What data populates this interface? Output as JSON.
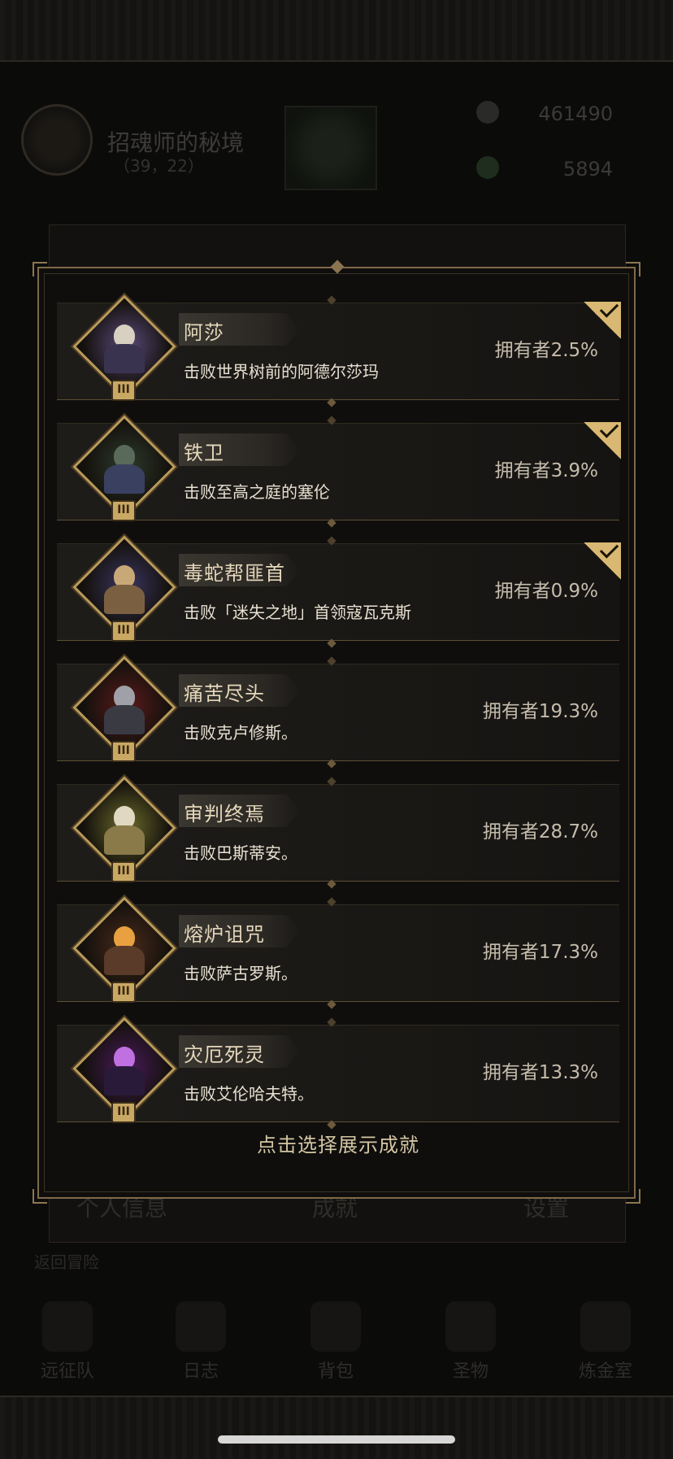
{
  "background": {
    "location_title": "招魂师的秘境",
    "location_coord": "（39，22）",
    "gem_count": "461490",
    "energy_count": "5894",
    "profile_tabs": [
      "个人信息",
      "成就",
      "设置"
    ],
    "back_label": "返回冒险",
    "nav": [
      {
        "label": "远征队",
        "icon": "horned-helmet-icon"
      },
      {
        "label": "日志",
        "icon": "scroll-icon"
      },
      {
        "label": "背包",
        "icon": "bag-icon"
      },
      {
        "label": "圣物",
        "icon": "relic-icon"
      },
      {
        "label": "炼金室",
        "icon": "alchemy-icon"
      }
    ]
  },
  "achievements": [
    {
      "title": "阿莎",
      "desc": "击败世界树前的阿德尔莎玛",
      "owners": "拥有者2.5%",
      "checked": true,
      "rank": "III",
      "colors": [
        "#5a4a7a",
        "#d8d0c0",
        "#3a3350"
      ]
    },
    {
      "title": "铁卫",
      "desc": "击败至高之庭的塞伦",
      "owners": "拥有者3.9%",
      "checked": true,
      "rank": "III",
      "colors": [
        "#2d3a2a",
        "#5a6a5a",
        "#3a4060"
      ]
    },
    {
      "title": "毒蛇帮匪首",
      "desc": "击败「迷失之地」首领寇瓦克斯",
      "owners": "拥有者0.9%",
      "checked": true,
      "rank": "III",
      "colors": [
        "#3a3560",
        "#c9a878",
        "#7a6040"
      ]
    },
    {
      "title": "痛苦尽头",
      "desc": "击败克卢修斯。",
      "owners": "拥有者19.3%",
      "checked": false,
      "rank": "III",
      "colors": [
        "#5a1a1a",
        "#a0a0a8",
        "#3a3a42"
      ]
    },
    {
      "title": "审判终焉",
      "desc": "击败巴斯蒂安。",
      "owners": "拥有者28.7%",
      "checked": false,
      "rank": "III",
      "colors": [
        "#6a6a2a",
        "#e0d8c0",
        "#8a7a4a"
      ]
    },
    {
      "title": "熔炉诅咒",
      "desc": "击败萨古罗斯。",
      "owners": "拥有者17.3%",
      "checked": false,
      "rank": "III",
      "colors": [
        "#4a2a1a",
        "#e8a040",
        "#5a3a28"
      ]
    },
    {
      "title": "灾厄死灵",
      "desc": "击败艾伦哈夫特。",
      "owners": "拥有者13.3%",
      "checked": false,
      "rank": "III",
      "colors": [
        "#4a1a5a",
        "#c070e0",
        "#2a1a3a"
      ]
    }
  ],
  "footer_hint": "点击选择展示成就"
}
